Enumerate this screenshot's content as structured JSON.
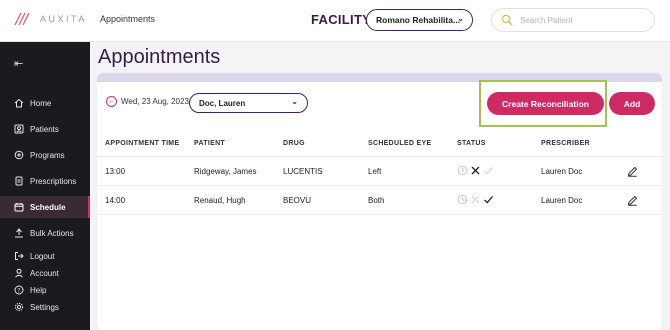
{
  "header": {
    "logo_text": "AUXITA",
    "breadcrumb": "Appointments",
    "facility_label": "FACILITY",
    "facility_value": "Romano Rehabilita...",
    "search_placeholder": "Search Patient"
  },
  "sidebar": {
    "items": [
      {
        "label": "Home",
        "icon": "home-icon"
      },
      {
        "label": "Patients",
        "icon": "patients-icon"
      },
      {
        "label": "Programs",
        "icon": "programs-icon"
      },
      {
        "label": "Prescriptions",
        "icon": "prescriptions-icon"
      },
      {
        "label": "Schedule",
        "icon": "calendar-icon",
        "active": true
      },
      {
        "label": "Bulk Actions",
        "icon": "bulk-actions-icon"
      }
    ],
    "bottom_items": [
      {
        "label": "Logout",
        "icon": "logout-icon"
      },
      {
        "label": "Account",
        "icon": "account-icon"
      },
      {
        "label": "Help",
        "icon": "help-icon"
      },
      {
        "label": "Settings",
        "icon": "settings-icon"
      }
    ]
  },
  "main": {
    "title": "Appointments",
    "date": "Wed, 23 Aug, 2023",
    "doctor_value": "Doc, Lauren",
    "create_button": "Create Reconciliation",
    "add_button": "Add"
  },
  "table": {
    "columns": [
      "APPOINTMENT TIME",
      "PATIENT",
      "DRUG",
      "SCHEDULED EYE",
      "STATUS",
      "PRESCRIBER"
    ],
    "rows": [
      {
        "time": "13:00",
        "patient": "Ridgeway, James",
        "drug": "LUCENTIS",
        "eye": "Left",
        "status": [
          "pending",
          "cancelled-active",
          "completed-inactive"
        ],
        "prescriber": "Lauren Doc"
      },
      {
        "time": "14:00",
        "patient": "Renaud, Hugh",
        "drug": "BEOVU",
        "eye": "Both",
        "status": [
          "pending",
          "cancelled-inactive",
          "completed-active"
        ],
        "prescriber": "Lauren Doc"
      }
    ]
  },
  "colors": {
    "accent": "#cf2a63",
    "brand_purple": "#4a1f5c",
    "highlight": "#a4c24a",
    "sidebar_bg": "#1b1b1f"
  }
}
